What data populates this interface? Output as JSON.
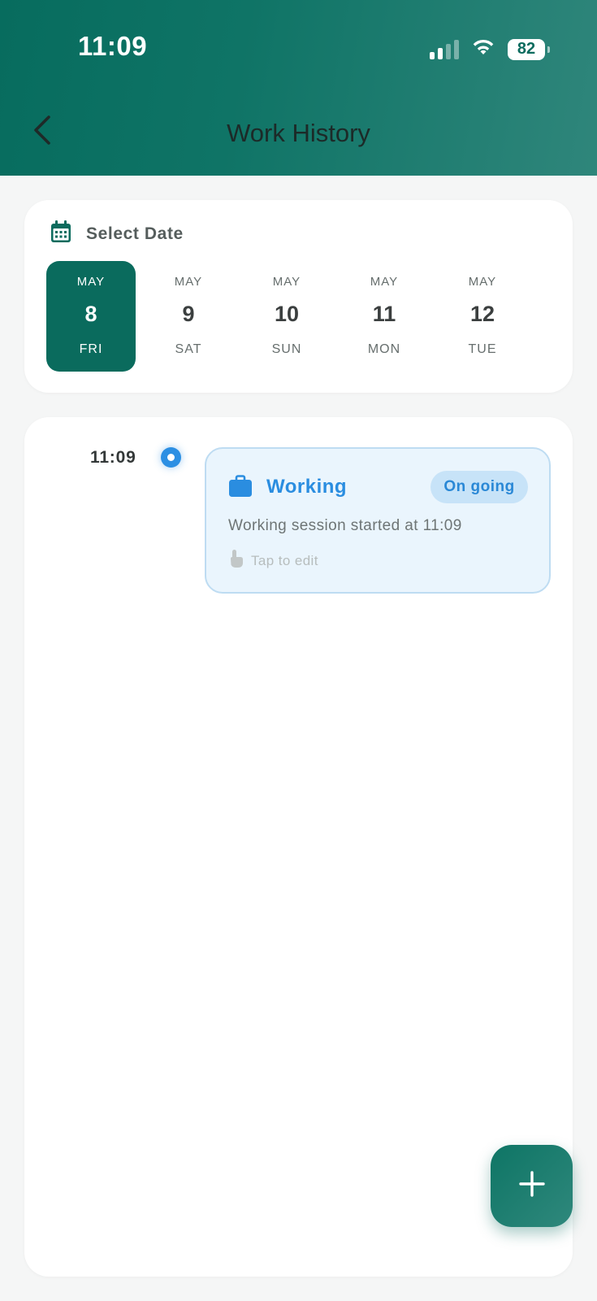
{
  "status_bar": {
    "time": "11:09",
    "battery": "82",
    "icons": [
      "signal-icon",
      "wifi-icon",
      "battery-icon"
    ]
  },
  "header": {
    "title": "Work History",
    "back_icon": "chevron-left-icon"
  },
  "date_selector": {
    "title": "Select Date",
    "icon": "calendar-icon",
    "days": [
      {
        "month": "MAY",
        "day": "8",
        "weekday": "FRI",
        "selected": true
      },
      {
        "month": "MAY",
        "day": "9",
        "weekday": "SAT",
        "selected": false
      },
      {
        "month": "MAY",
        "day": "10",
        "weekday": "SUN",
        "selected": false
      },
      {
        "month": "MAY",
        "day": "11",
        "weekday": "MON",
        "selected": false
      },
      {
        "month": "MAY",
        "day": "12",
        "weekday": "TUE",
        "selected": false
      }
    ]
  },
  "timeline": {
    "entries": [
      {
        "time": "11:09",
        "title": "Working",
        "icon": "briefcase-icon",
        "status": "On going",
        "description": "Working session started at 11:09",
        "hint": "Tap to edit",
        "hint_icon": "tap-hand-icon"
      }
    ]
  },
  "fab": {
    "icon": "plus-icon"
  },
  "colors": {
    "primary": "#0a6b5d",
    "accent_blue": "#2a8de0",
    "card_blue_bg": "#eaf5fd",
    "badge_bg": "#c7e3f8"
  }
}
